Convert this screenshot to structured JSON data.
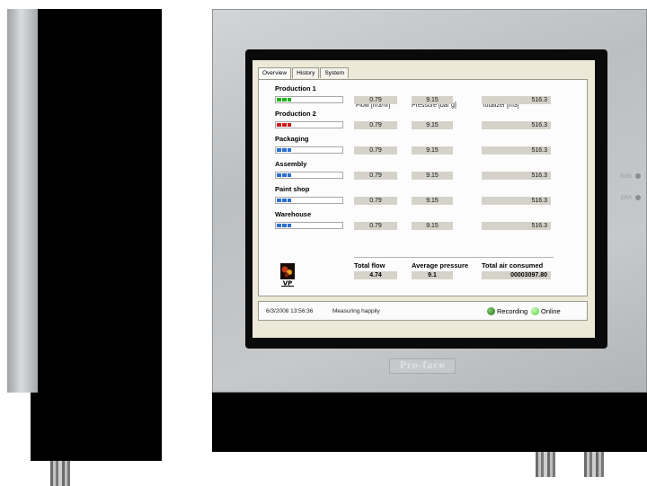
{
  "hmi": {
    "tabs": [
      {
        "label": "Overview"
      },
      {
        "label": "History"
      },
      {
        "label": "System"
      }
    ],
    "columns": {
      "flow": "Flow [m3/hr]",
      "pressure": "Pressure [bar g]",
      "totalizer": "Totalizer [m3]"
    },
    "zones": [
      {
        "name": "Production 1",
        "flow": "0.79",
        "pressure": "9.15",
        "totalizer": "516.3",
        "status_color": "#22b21e",
        "gauge_level": 0.22
      },
      {
        "name": "Production 2",
        "flow": "0.79",
        "pressure": "9.15",
        "totalizer": "516.3",
        "status_color": "#d01b1b",
        "gauge_level": 0.22
      },
      {
        "name": "Packaging",
        "flow": "0.79",
        "pressure": "9.15",
        "totalizer": "516.3",
        "status_color": "#2a6fd2",
        "gauge_level": 0.22
      },
      {
        "name": "Assembly",
        "flow": "0.79",
        "pressure": "9.15",
        "totalizer": "516.3",
        "status_color": "#2a6fd2",
        "gauge_level": 0.22
      },
      {
        "name": "Paint shop",
        "flow": "0.79",
        "pressure": "9.15",
        "totalizer": "516.3",
        "status_color": "#2a6fd2",
        "gauge_level": 0.22
      },
      {
        "name": "Warehouse",
        "flow": "0.79",
        "pressure": "9.15",
        "totalizer": "516.3",
        "status_color": "#2a6fd2",
        "gauge_level": 0.22
      }
    ],
    "totals": {
      "total_flow_label": "Total flow",
      "total_flow_value": "4.74",
      "avg_pressure_label": "Average pressure",
      "avg_pressure_value": "9.1",
      "total_air_label": "Total air consumed",
      "total_air_value": "00003097.80"
    },
    "logo_text": "VP",
    "status": {
      "datetime": "6/3/2008 13:56:36",
      "message": "Measuring happily",
      "recording_label": "Recording",
      "recording_color": "#2e7d1e",
      "online_label": "Online",
      "online_color": "#55d43a"
    }
  },
  "device": {
    "brand": "Pro-face",
    "led_labels": [
      "RUN",
      "ERR"
    ]
  }
}
